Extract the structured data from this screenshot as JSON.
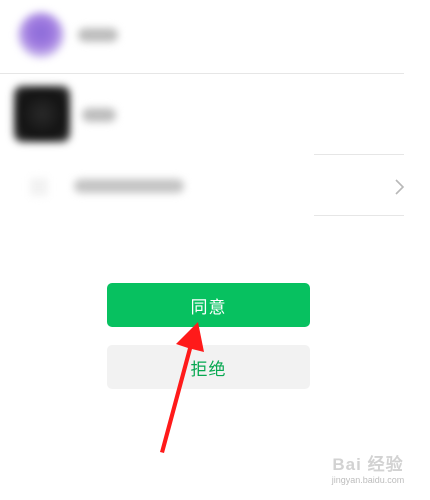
{
  "contacts": [
    {
      "avatar": "purple-avatar",
      "name": ""
    },
    {
      "avatar": "dark-avatar",
      "name": ""
    }
  ],
  "settings_row": {
    "label": "",
    "icon": "chevron-right-icon"
  },
  "actions": {
    "accept_label": "同意",
    "reject_label": "拒绝"
  },
  "annotation": {
    "icon": "red-arrow-icon"
  },
  "watermark": {
    "brand": "Bai 经验",
    "url": "jingyan.baidu.com"
  },
  "colors": {
    "accept_bg": "#07c160",
    "reject_bg": "#f2f2f2",
    "reject_text": "#07a851",
    "arrow": "#ff1a1a",
    "divider": "#e6e6e6"
  }
}
